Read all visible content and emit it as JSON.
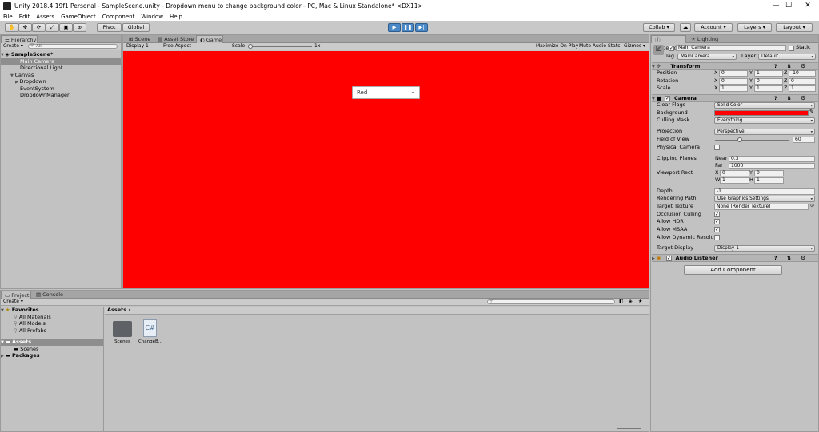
{
  "window": {
    "title": "Unity 2018.4.19f1 Personal - SampleScene.unity - Dropdown menu to change background color - PC, Mac & Linux Standalone* <DX11>",
    "minimize": "—",
    "maximize": "☐",
    "close": "✕"
  },
  "menu": [
    "File",
    "Edit",
    "Assets",
    "GameObject",
    "Component",
    "Window",
    "Help"
  ],
  "toolbar": {
    "pivot": "Pivot",
    "global": "Global",
    "collab": "Collab ▾",
    "account": "Account ▾",
    "layers": "Layers ▾",
    "layout": "Layout ▾"
  },
  "hierarchy": {
    "tab": "Hierarchy",
    "create": "Create ▾",
    "search": "All",
    "scene": "SampleScene*",
    "items": [
      "Main Camera",
      "Directional Light",
      "Canvas",
      "Dropdown",
      "EventSystem",
      "DropdownManager"
    ]
  },
  "center": {
    "tabs": [
      "Scene",
      "Asset Store",
      "Game"
    ],
    "display": "Display 1",
    "aspect": "Free Aspect",
    "scale_label": "Scale",
    "scale_value": "1x",
    "maximize_on_play": "Maximize On Play",
    "mute_audio": "Mute Audio",
    "stats": "Stats",
    "gizmos": "Gizmos ▾",
    "game_bg": "#ff0000",
    "dropdown_value": "Red"
  },
  "project": {
    "tabs": [
      "Project",
      "Console"
    ],
    "create": "Create ▾",
    "favorites": "Favorites",
    "fav_items": [
      "All Materials",
      "All Models",
      "All Prefabs"
    ],
    "assets": "Assets",
    "asset_children": [
      "Scenes"
    ],
    "packages": "Packages",
    "breadcrumb": "Assets",
    "files": [
      {
        "name": "Scenes",
        "icon": "folder-icon"
      },
      {
        "name": "ChangeB...",
        "icon": "csharp-script-icon",
        "glyph": "C#"
      }
    ]
  },
  "inspector": {
    "tabs": [
      "Inspector",
      "Lighting"
    ],
    "object_name": "Main Camera",
    "static": "Static",
    "tag_label": "Tag",
    "tag": "MainCamera",
    "layer_label": "Layer",
    "layer": "Default",
    "transform": {
      "title": "Transform",
      "rows": [
        {
          "label": "Position",
          "x": "0",
          "y": "1",
          "z": "-10"
        },
        {
          "label": "Rotation",
          "x": "0",
          "y": "0",
          "z": "0"
        },
        {
          "label": "Scale",
          "x": "1",
          "y": "1",
          "z": "1"
        }
      ]
    },
    "camera": {
      "title": "Camera",
      "clear_flags_label": "Clear Flags",
      "clear_flags": "Solid Color",
      "background_label": "Background",
      "background_color": "#ff0000",
      "culling_mask_label": "Culling Mask",
      "culling_mask": "Everything",
      "projection_label": "Projection",
      "projection": "Perspective",
      "fov_label": "Field of View",
      "fov": "60",
      "fov_fraction": 0.333,
      "physical_label": "Physical Camera",
      "clipping_label": "Clipping Planes",
      "near_label": "Near",
      "near": "0.3",
      "far_label": "Far",
      "far": "1000",
      "viewport_label": "Viewport Rect",
      "vx": "0",
      "vy": "0",
      "vw": "1",
      "vh": "1",
      "depth_label": "Depth",
      "depth": "-1",
      "rendering_path_label": "Rendering Path",
      "rendering_path": "Use Graphics Settings",
      "target_texture_label": "Target Texture",
      "target_texture": "None (Render Texture)",
      "occlusion_label": "Occlusion Culling",
      "hdr_label": "Allow HDR",
      "msaa_label": "Allow MSAA",
      "dynres_label": "Allow Dynamic Resoluti",
      "target_display_label": "Target Display",
      "target_display": "Display 1"
    },
    "audio_listener": "Audio Listener",
    "add_component": "Add Component"
  }
}
